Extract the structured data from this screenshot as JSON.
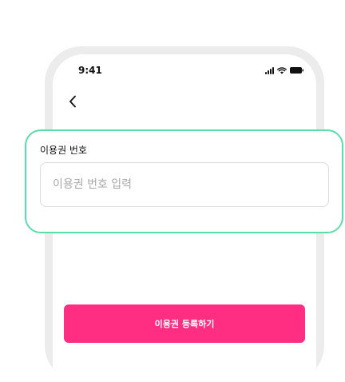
{
  "status_bar": {
    "time": "9:41",
    "icons": [
      "signal-icon",
      "wifi-icon",
      "battery-icon"
    ]
  },
  "nav": {
    "back_icon": "chevron-left-icon"
  },
  "form": {
    "label": "이용권 번호",
    "input_value": "",
    "input_placeholder": "이용권 번호 입력"
  },
  "submit": {
    "label": "이용권 등록하기"
  },
  "colors": {
    "highlight_border": "#5edbab",
    "button_background": "#ff2e83",
    "button_text": "#ffffff",
    "phone_frame": "#ececec"
  }
}
